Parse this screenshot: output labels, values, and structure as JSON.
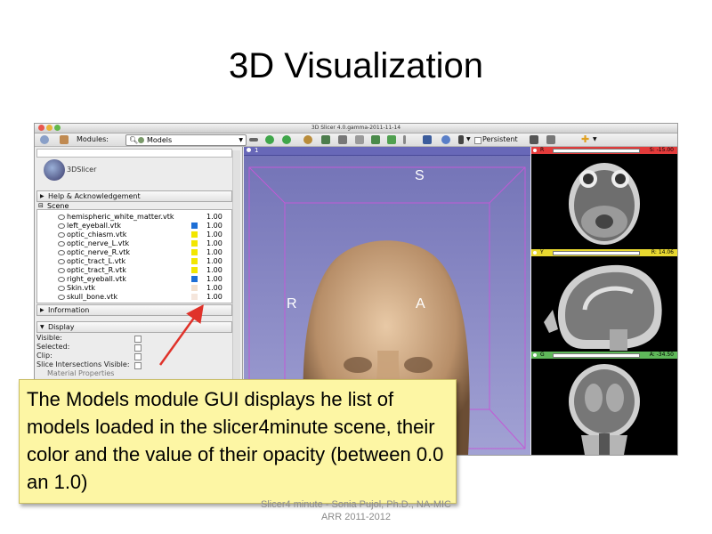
{
  "slide": {
    "title": "3D Visualization",
    "footer_line1": "Slicer4 minute - Sonia Pujol, Ph.D., NA-MIC",
    "footer_line2": "ARR 2011-2012",
    "callout": "The Models module GUI displays he list of models loaded in the slicer4minute scene, their color and the value of their opacity (between 0.0 an 1.0)"
  },
  "window": {
    "title": "3D Slicer 4.0.gamma-2011-11-14"
  },
  "toolbar": {
    "modules_label": "Modules:",
    "module_selected": "Models",
    "persistent_label": "Persistent"
  },
  "left_panel": {
    "logo_text": "3DSlicer",
    "help_section": "Help & Acknowledgement",
    "scene_label": "Scene",
    "models": [
      {
        "name": "hemispheric_white_matter.vtk",
        "opacity": "1.00",
        "color": ""
      },
      {
        "name": "left_eyeball.vtk",
        "opacity": "1.00",
        "color": "#1e6fd6"
      },
      {
        "name": "optic_chiasm.vtk",
        "opacity": "1.00",
        "color": "#f2e600"
      },
      {
        "name": "optic_nerve_L.vtk",
        "opacity": "1.00",
        "color": "#f2e600"
      },
      {
        "name": "optic_nerve_R.vtk",
        "opacity": "1.00",
        "color": "#f2e600"
      },
      {
        "name": "optic_tract_L.vtk",
        "opacity": "1.00",
        "color": "#f2e600"
      },
      {
        "name": "optic_tract_R.vtk",
        "opacity": "1.00",
        "color": "#f2e600"
      },
      {
        "name": "right_eyeball.vtk",
        "opacity": "1.00",
        "color": "#1e6fd6"
      },
      {
        "name": "Skin.vtk",
        "opacity": "1.00",
        "color": "#f2e0cf"
      },
      {
        "name": "skull_bone.vtk",
        "opacity": "1.00",
        "color": "#f5e6dc"
      }
    ],
    "information_section": "Information",
    "display_section": "Display",
    "display_props": {
      "visible": "Visible:",
      "selected": "Selected:",
      "clip": "Clip:",
      "slice_intersections": "Slice Intersections Visible:",
      "material": "Material Properties"
    }
  },
  "view3d": {
    "tab": "1",
    "superior": "S",
    "anterior": "A",
    "right": "R",
    "left": "L"
  },
  "slices": {
    "red": {
      "name": "R",
      "offset": "S: -15.00",
      "color": "#e33b3b"
    },
    "yellow": {
      "name": "Y",
      "offset": "R: 14.06",
      "color": "#e8d830"
    },
    "green": {
      "name": "G",
      "offset": "A: -34.50",
      "color": "#5fb85a"
    }
  }
}
